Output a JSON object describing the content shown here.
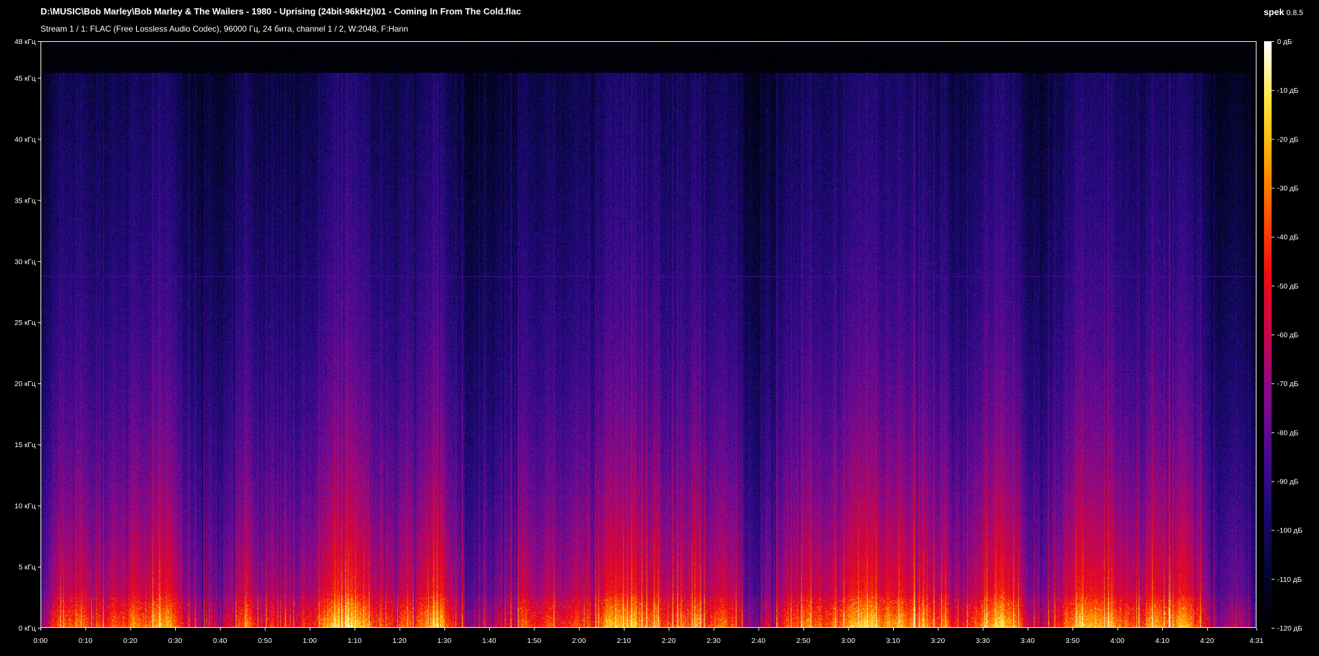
{
  "window": {
    "title": "D:\\MUSIC\\Bob Marley\\Bob Marley & The Wailers - 1980 - Uprising (24bit-96kHz)\\01 - Coming In From The Cold.flac",
    "stream_info": "Stream 1 / 1: FLAC (Free Lossless Audio Codec), 96000 Гц, 24 бита, channel 1 / 2, W:2048, F:Hann",
    "app_name": "spek",
    "app_version": "0.8.5"
  },
  "spectrogram": {
    "duration_seconds": 271,
    "max_frequency_khz": 48,
    "content_cutoff_khz": 45.5,
    "tone_line_khz": 28.8,
    "db_min": -120,
    "db_max": 0
  },
  "axes": {
    "y_ticks": [
      {
        "value": 0,
        "label": "0 кГц"
      },
      {
        "value": 5,
        "label": "5 кГц"
      },
      {
        "value": 10,
        "label": "10 кГц"
      },
      {
        "value": 15,
        "label": "15 кГц"
      },
      {
        "value": 20,
        "label": "20 кГц"
      },
      {
        "value": 25,
        "label": "25 кГц"
      },
      {
        "value": 30,
        "label": "30 кГц"
      },
      {
        "value": 35,
        "label": "35 кГц"
      },
      {
        "value": 40,
        "label": "40 кГц"
      },
      {
        "value": 45,
        "label": "45 кГц"
      },
      {
        "value": 48,
        "label": "48 кГц"
      }
    ],
    "x_ticks": [
      {
        "value": 0,
        "label": "0:00"
      },
      {
        "value": 10,
        "label": "0:10"
      },
      {
        "value": 20,
        "label": "0:20"
      },
      {
        "value": 30,
        "label": "0:30"
      },
      {
        "value": 40,
        "label": "0:40"
      },
      {
        "value": 50,
        "label": "0:50"
      },
      {
        "value": 60,
        "label": "1:00"
      },
      {
        "value": 70,
        "label": "1:10"
      },
      {
        "value": 80,
        "label": "1:20"
      },
      {
        "value": 90,
        "label": "1:30"
      },
      {
        "value": 100,
        "label": "1:40"
      },
      {
        "value": 110,
        "label": "1:50"
      },
      {
        "value": 120,
        "label": "2:00"
      },
      {
        "value": 130,
        "label": "2:10"
      },
      {
        "value": 140,
        "label": "2:20"
      },
      {
        "value": 150,
        "label": "2:30"
      },
      {
        "value": 160,
        "label": "2:40"
      },
      {
        "value": 170,
        "label": "2:50"
      },
      {
        "value": 180,
        "label": "3:00"
      },
      {
        "value": 190,
        "label": "3:10"
      },
      {
        "value": 200,
        "label": "3:20"
      },
      {
        "value": 210,
        "label": "3:30"
      },
      {
        "value": 220,
        "label": "3:40"
      },
      {
        "value": 230,
        "label": "3:50"
      },
      {
        "value": 240,
        "label": "4:00"
      },
      {
        "value": 250,
        "label": "4:10"
      },
      {
        "value": 260,
        "label": "4:20"
      },
      {
        "value": 271,
        "label": "4:31"
      }
    ]
  },
  "colorbar": {
    "ticks": [
      {
        "value": 0,
        "label": "0 дБ"
      },
      {
        "value": -10,
        "label": "-10 дБ"
      },
      {
        "value": -20,
        "label": "-20 дБ"
      },
      {
        "value": -30,
        "label": "-30 дБ"
      },
      {
        "value": -40,
        "label": "-40 дБ"
      },
      {
        "value": -50,
        "label": "-50 дБ"
      },
      {
        "value": -60,
        "label": "-60 дБ"
      },
      {
        "value": -70,
        "label": "-70 дБ"
      },
      {
        "value": -80,
        "label": "-80 дБ"
      },
      {
        "value": -90,
        "label": "-90 дБ"
      },
      {
        "value": -100,
        "label": "-100 дБ"
      },
      {
        "value": -110,
        "label": "-110 дБ"
      },
      {
        "value": -120,
        "label": "-120 дБ"
      }
    ],
    "colors": [
      "#000000",
      "#060635",
      "#1c0a78",
      "#4d0a94",
      "#8a0a8a",
      "#c8064e",
      "#ee0a14",
      "#ff5000",
      "#ffa400",
      "#ffe640",
      "#ffffff"
    ]
  }
}
